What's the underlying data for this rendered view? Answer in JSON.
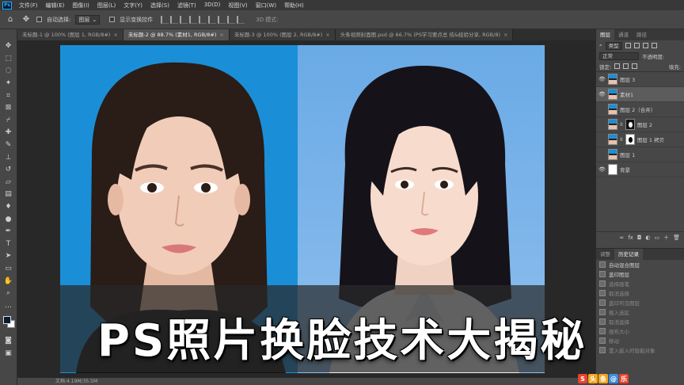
{
  "app": {
    "logo": "Ps",
    "menu": [
      "文件(F)",
      "编辑(E)",
      "图像(I)",
      "图层(L)",
      "文字(Y)",
      "选择(S)",
      "滤镜(T)",
      "3D(D)",
      "视图(V)",
      "窗口(W)",
      "帮助(H)"
    ]
  },
  "options": {
    "auto_select_label": "自动选择:",
    "auto_select_value": "图层",
    "show_transform_label": "显示变换控件",
    "mode_3d": "3D 模式:"
  },
  "tabs": [
    {
      "label": "未标题-1 @ 100% (图层 1, RGB/8#)",
      "active": false
    },
    {
      "label": "未标题-2 @ 88.7% (素材1, RGB/8#)",
      "active": true
    },
    {
      "label": "未标题-3 @ 100% (图层 2, RGB/8#)",
      "active": false
    },
    {
      "label": "头条视频封面图.psd @ 66.7% (PS学习要点总 结&经验分享, RGB/8)",
      "active": false
    }
  ],
  "status": "文档:4.19M/35.5M",
  "title_overlay": "PS照片换脸技术大揭秘",
  "panels": {
    "tabs": [
      "图层",
      "通道",
      "路径"
    ],
    "kind_label": "类型",
    "blend_mode": "正常",
    "opacity_label": "不透明度:",
    "lock_label": "锁定:",
    "fill_label": "填充:",
    "layers": [
      {
        "name": "图层 3",
        "visible": true,
        "thumb": "blue",
        "selected": false,
        "mask": ""
      },
      {
        "name": "素材1",
        "visible": true,
        "thumb": "blue",
        "selected": true,
        "mask": ""
      },
      {
        "name": "图层 2（合并）",
        "visible": false,
        "thumb": "blue",
        "selected": false,
        "mask": ""
      },
      {
        "name": "图层 2",
        "visible": false,
        "thumb": "blue",
        "selected": false,
        "mask": "white"
      },
      {
        "name": "图层 1 拷贝",
        "visible": false,
        "thumb": "blue",
        "selected": false,
        "mask": "black"
      },
      {
        "name": "图层 1",
        "visible": false,
        "thumb": "blue",
        "selected": false,
        "mask": ""
      },
      {
        "name": "背景",
        "visible": true,
        "thumb": "white",
        "selected": false,
        "mask": ""
      }
    ],
    "history_tabs": [
      "调整",
      "历史记录"
    ],
    "history": [
      {
        "label": "自动混合图层",
        "dim": false
      },
      {
        "label": "盖印图层",
        "dim": false
      },
      {
        "label": "选择画笔",
        "dim": true
      },
      {
        "label": "取消选择",
        "dim": true
      },
      {
        "label": "盖印可见图层",
        "dim": true
      },
      {
        "label": "载入选区",
        "dim": true
      },
      {
        "label": "取消选择",
        "dim": true
      },
      {
        "label": "画布大小",
        "dim": true
      },
      {
        "label": "移动",
        "dim": true
      },
      {
        "label": "置入嵌入的智能对象",
        "dim": true
      }
    ]
  },
  "watermark": {
    "letters": [
      "S",
      "头",
      "条",
      "@",
      "乐"
    ],
    "colors": [
      "#e8442e",
      "#f3a51b",
      "#f3a51b",
      "#3c8fe0",
      "#e8442e"
    ]
  }
}
